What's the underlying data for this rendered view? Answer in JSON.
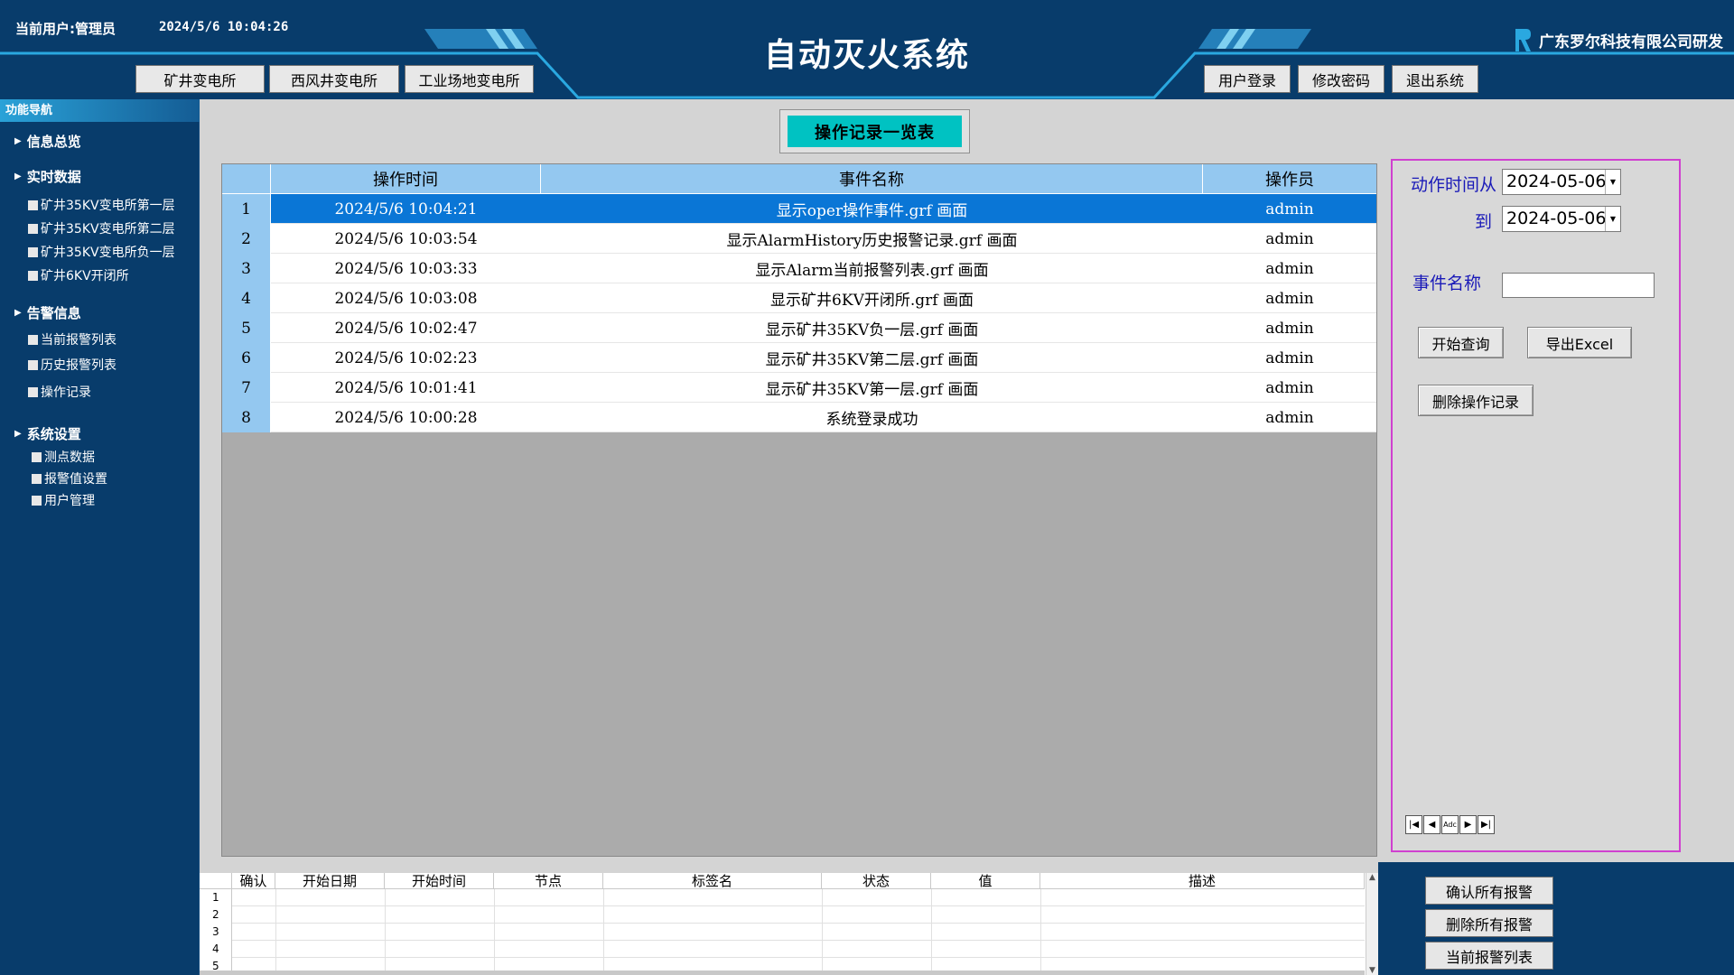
{
  "header": {
    "current_user": "当前用户:管理员",
    "datetime": "2024/5/6  10:04:26",
    "title": "自动灭火系统",
    "company": "广东罗尔科技有限公司研发",
    "station_tabs": [
      "矿井变电所",
      "西风井变电所",
      "工业场地变电所"
    ],
    "right_buttons": [
      "用户登录",
      "修改密码",
      "退出系统"
    ]
  },
  "sidebar": {
    "title": "功能导航",
    "sections": [
      {
        "label": "信息总览",
        "items": []
      },
      {
        "label": "实时数据",
        "items": [
          "矿井35KV变电所第一层",
          "矿井35KV变电所第二层",
          "矿井35KV变电所负一层",
          "矿井6KV开闭所"
        ]
      },
      {
        "label": "告警信息",
        "items": [
          "当前报警列表",
          "历史报警列表",
          "操作记录"
        ]
      },
      {
        "label": "系统设置",
        "items": [
          "测点数据",
          "报警值设置",
          "用户管理"
        ]
      }
    ]
  },
  "main": {
    "title": "操作记录一览表",
    "columns": [
      "操作时间",
      "事件名称",
      "操作员"
    ],
    "rows": [
      {
        "n": "1",
        "time": "2024/5/6 10:04:21",
        "event": "显示oper操作事件.grf 画面",
        "operator": "admin"
      },
      {
        "n": "2",
        "time": "2024/5/6 10:03:54",
        "event": "显示AlarmHistory历史报警记录.grf 画面",
        "operator": "admin"
      },
      {
        "n": "3",
        "time": "2024/5/6 10:03:33",
        "event": "显示Alarm当前报警列表.grf 画面",
        "operator": "admin"
      },
      {
        "n": "4",
        "time": "2024/5/6 10:03:08",
        "event": "显示矿井6KV开闭所.grf 画面",
        "operator": "admin"
      },
      {
        "n": "5",
        "time": "2024/5/6 10:02:47",
        "event": "显示矿井35KV负一层.grf 画面",
        "operator": "admin"
      },
      {
        "n": "6",
        "time": "2024/5/6 10:02:23",
        "event": "显示矿井35KV第二层.grf 画面",
        "operator": "admin"
      },
      {
        "n": "7",
        "time": "2024/5/6 10:01:41",
        "event": "显示矿井35KV第一层.grf 画面",
        "operator": "admin"
      },
      {
        "n": "8",
        "time": "2024/5/6 10:00:28",
        "event": "系统登录成功",
        "operator": "admin"
      }
    ],
    "selected_row": 1
  },
  "query": {
    "from_label": "动作时间从",
    "from_value": "2024-05-06",
    "to_label": "到",
    "to_value": "2024-05-06",
    "event_label": "事件名称",
    "event_value": "",
    "search_button": "开始查询",
    "export_button": "导出Excel",
    "delete_button": "删除操作记录",
    "nav_mid": "Adc"
  },
  "alarm_table": {
    "columns": [
      "确认",
      "开始日期",
      "开始时间",
      "节点",
      "标签名",
      "状态",
      "值",
      "描述"
    ],
    "row_numbers": [
      "1",
      "2",
      "3",
      "4",
      "5"
    ]
  },
  "alarm_buttons": [
    "确认所有报警",
    "删除所有报警",
    "当前报警列表"
  ],
  "colors": {
    "header_bg": "#083c6b",
    "accent_cyan": "#00c2c2",
    "selected_row": "#0a76d6",
    "grid_header": "#94c8f0",
    "panel_border": "#d040d0",
    "label_blue": "#1a1ab8"
  }
}
